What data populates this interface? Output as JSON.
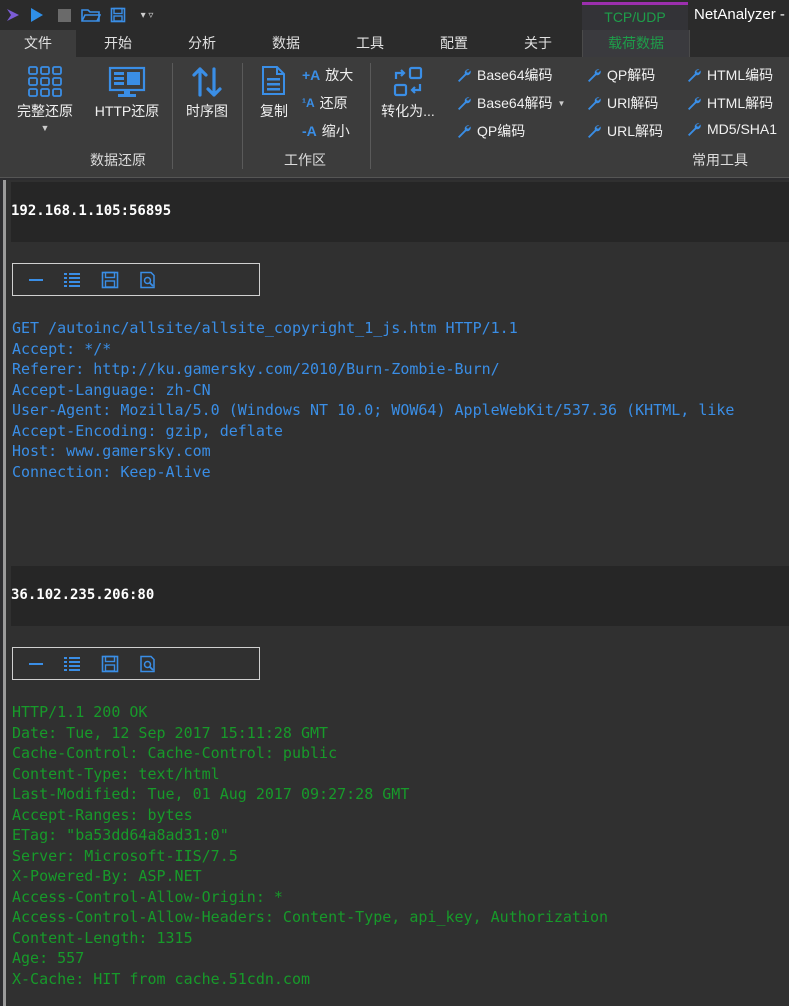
{
  "window": {
    "title": "NetAnalyzer -",
    "context_tab_group": "TCP/UDP"
  },
  "tabs": [
    {
      "label": "文件"
    },
    {
      "label": "开始"
    },
    {
      "label": "分析"
    },
    {
      "label": "数据"
    },
    {
      "label": "工具"
    },
    {
      "label": "配置"
    },
    {
      "label": "关于"
    },
    {
      "label": "载荷数据"
    }
  ],
  "ribbon": {
    "full_restore": "完整还原",
    "http_restore": "HTTP还原",
    "sequence_chart": "时序图",
    "group_restore": "数据还原",
    "copy": "复制",
    "zoom_in": "放大",
    "restore": "还原",
    "zoom_out": "缩小",
    "group_workspace": "工作区",
    "convert_to": "转化为...",
    "tools": {
      "base64_encode": "Base64编码",
      "base64_decode": "Base64解码",
      "qp_encode": "QP编码",
      "qp_decode": "QP解码",
      "url_decode_1": "URl解码",
      "url_decode_2": "URL解码",
      "html_encode": "HTML编码",
      "html_decode": "HTML解码",
      "md5_sha1": "MD5/SHA1"
    },
    "group_tools": "常用工具"
  },
  "streams": [
    {
      "endpoint": "192.168.1.105:56895",
      "lines": [
        "GET /autoinc/allsite/allsite_copyright_1_js.htm HTTP/1.1",
        "Accept: */*",
        "Referer: http://ku.gamersky.com/2010/Burn-Zombie-Burn/",
        "Accept-Language: zh-CN",
        "User-Agent: Mozilla/5.0 (Windows NT 10.0; WOW64) AppleWebKit/537.36 (KHTML, like",
        "Accept-Encoding: gzip, deflate",
        "Host: www.gamersky.com",
        "Connection: Keep-Alive"
      ]
    },
    {
      "endpoint": "36.102.235.206:80",
      "lines": [
        "HTTP/1.1 200 OK",
        "Date: Tue, 12 Sep 2017 15:11:28 GMT",
        "Cache-Control: Cache-Control: public",
        "Content-Type: text/html",
        "Last-Modified: Tue, 01 Aug 2017 09:27:28 GMT",
        "Accept-Ranges: bytes",
        "ETag: \"ba53dd64a8ad31:0\"",
        "Server: Microsoft-IIS/7.5",
        "X-Powered-By: ASP.NET",
        "Access-Control-Allow-Origin: *",
        "Access-Control-Allow-Headers: Content-Type, api_key, Authorization",
        "Content-Length: 1315",
        "Age: 557",
        "X-Cache: HIT from cache.51cdn.com"
      ]
    }
  ],
  "colors": {
    "request_text": "#3a8ee6",
    "response_text": "#179a2a",
    "accent_icon": "#3a8ee6",
    "context_tab_green": "#1e9e4a",
    "context_tab_border": "#9b2fae"
  }
}
